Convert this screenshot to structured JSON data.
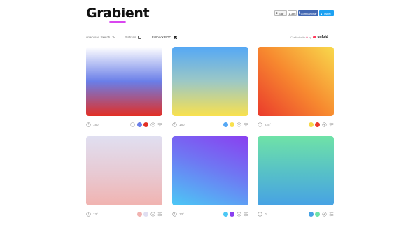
{
  "header": {
    "logo": "Grabient",
    "star_label": "Star",
    "star_count": "1,396",
    "share_label": "Compartilhar",
    "tweet_label": "Tweet"
  },
  "options": {
    "download_sketch": "download Sketch",
    "prefixes": "Prefixes",
    "fallback_bgc": "Fallback BGC",
    "prefixes_checked": false,
    "fallback_checked": true
  },
  "credit": {
    "crafted_with": "Crafted with",
    "by": "by",
    "brand": "unfold"
  },
  "gradients": [
    {
      "angle": "180°",
      "stops": [
        "#ffffff",
        "#6a7ee8",
        "#e32e24"
      ]
    },
    {
      "angle": "180°",
      "stops": [
        "#55a8f5",
        "#f9e14e"
      ]
    },
    {
      "angle": "225°",
      "stops": [
        "#f8d94c",
        "#ea3a2c"
      ]
    },
    {
      "angle": "13°",
      "stops": [
        "#f1b3b0",
        "#e0dff1"
      ]
    },
    {
      "angle": "13°",
      "stops": [
        "#4cc8f5",
        "#8a3ff0"
      ]
    },
    {
      "angle": "0°",
      "stops": [
        "#47a2e4",
        "#6fe2a7"
      ]
    }
  ],
  "colors": {
    "accent": "#d946ef",
    "facebook": "#4267b2",
    "twitter": "#1da1f2",
    "unfold": "#ff3b5c"
  },
  "icons": {
    "angle": "circle-arrow-icon",
    "add_stop": "plus-circle-icon",
    "settings": "sliders-icon",
    "download": "download-icon"
  }
}
